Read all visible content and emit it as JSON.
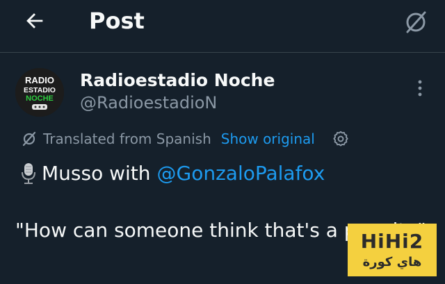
{
  "header": {
    "title": "Post"
  },
  "post": {
    "author_name": "Radioestadio Noche",
    "author_handle": "@RadioestadioN",
    "avatar_text": {
      "line1": "RADIO",
      "line2": "ESTADIO",
      "line3": "NOCHE"
    },
    "translation_notice": "Translated from Spanish",
    "show_original_label": "Show original",
    "text_line1": "Musso with",
    "mention": "@GonzaloPalafox",
    "quote": "\"How can someone think that's a penalty\""
  },
  "watermark": {
    "line1": "HiHi2",
    "line2": "هاي كورة"
  },
  "colors": {
    "background": "#15202b",
    "accent": "#1d9bf0",
    "secondary_text": "#8b98a5",
    "watermark_bg": "#f4d03f"
  },
  "icons": [
    "back-arrow-icon",
    "grok-icon",
    "more-options-icon",
    "translate-icon",
    "settings-gear-icon",
    "microphone-icon"
  ]
}
